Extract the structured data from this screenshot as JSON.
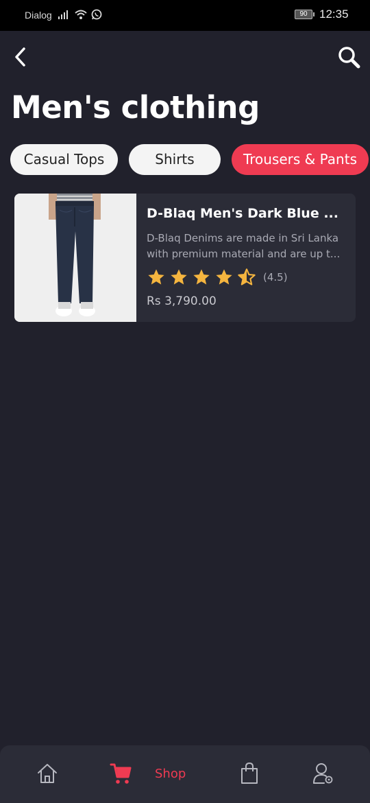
{
  "status_bar": {
    "carrier": "Dialog",
    "battery": "90",
    "time": "12:35"
  },
  "header": {
    "title": "Men's clothing",
    "back_icon": "chevron-left-icon",
    "search_icon": "search-icon"
  },
  "categories": [
    {
      "label": "Casual Tops",
      "active": false
    },
    {
      "label": "Shirts",
      "active": false
    },
    {
      "label": "Trousers & Pants",
      "active": true
    }
  ],
  "products": [
    {
      "name": "D-Blaq Men's Dark Blue ...",
      "description": "D-Blaq Denims are made in Sri Lanka with premium material and are up t...",
      "rating": 4.5,
      "rating_text": "(4.5)",
      "price": "Rs 3,790.00"
    }
  ],
  "bottom_nav": {
    "items": [
      {
        "icon": "home-icon",
        "active": false
      },
      {
        "icon": "cart-icon",
        "label": "Shop",
        "active": true
      },
      {
        "icon": "shopping-bag-icon",
        "active": false
      },
      {
        "icon": "user-settings-icon",
        "active": false
      }
    ]
  },
  "colors": {
    "background": "#21212c",
    "card": "#2b2c37",
    "accent": "#ef3b52",
    "star": "#f5b53f"
  }
}
